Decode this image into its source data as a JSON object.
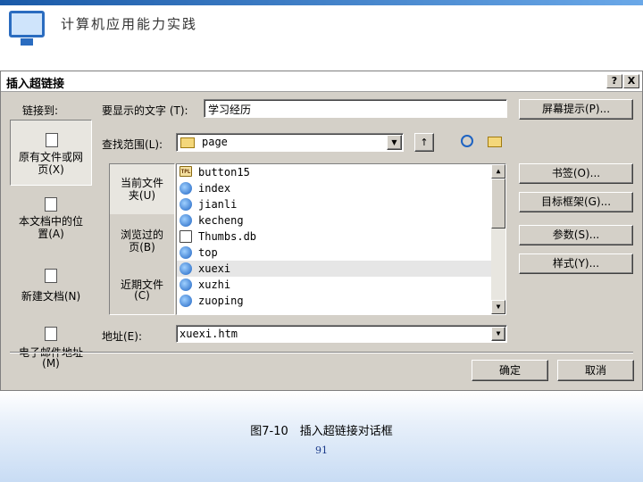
{
  "slide": {
    "title": "计算机应用能力实践",
    "caption": "图7-10　插入超链接对话框",
    "page_number": "91"
  },
  "dialog": {
    "title": "插入超链接",
    "help_label": "?",
    "close_label": "X",
    "link_to_label": "链接到:",
    "display_text_label": "要显示的文字 (T):",
    "display_text_value": "学习经历",
    "screen_tip_button": "屏幕提示(P)...",
    "look_in_label": "查找范围(L):",
    "look_in_value": "page",
    "bookmark_button": "书签(O)...",
    "target_frame_button": "目标框架(G)...",
    "params_button": "参数(S)...",
    "style_button": "样式(Y)...",
    "address_label": "地址(E):",
    "address_value": "xuexi.htm",
    "ok_button": "确定",
    "cancel_button": "取消"
  },
  "left_nav": [
    {
      "label_line1": "原有文件或网",
      "label_line2": "页(X)",
      "selected": true
    },
    {
      "label_line1": "本文档中的位",
      "label_line2": "置(A)",
      "selected": false
    },
    {
      "label_line1": "新建文档(N)",
      "label_line2": "",
      "selected": false
    },
    {
      "label_line1": "电子邮件地址",
      "label_line2": "(M)",
      "selected": false
    }
  ],
  "mid_nav": [
    {
      "label_line1": "当前文件",
      "label_line2": "夹(U)",
      "selected": true
    },
    {
      "label_line1": "浏览过的",
      "label_line2": "页(B)",
      "selected": false
    },
    {
      "label_line1": "近期文件",
      "label_line2": "(C)",
      "selected": false
    }
  ],
  "files": [
    {
      "name": "button15",
      "icon": "template-icon",
      "selected": false
    },
    {
      "name": "index",
      "icon": "ie-page-icon",
      "selected": false
    },
    {
      "name": "jianli",
      "icon": "ie-page-icon",
      "selected": false
    },
    {
      "name": "kecheng",
      "icon": "ie-page-icon",
      "selected": false
    },
    {
      "name": "Thumbs.db",
      "icon": "db-file-icon",
      "selected": false
    },
    {
      "name": "top",
      "icon": "ie-page-icon",
      "selected": false
    },
    {
      "name": "xuexi",
      "icon": "ie-page-icon",
      "selected": true
    },
    {
      "name": "xuzhi",
      "icon": "ie-page-icon",
      "selected": false
    },
    {
      "name": "zuoping",
      "icon": "ie-page-icon",
      "selected": false
    }
  ],
  "icons": {
    "tpl_text": "TPL"
  }
}
